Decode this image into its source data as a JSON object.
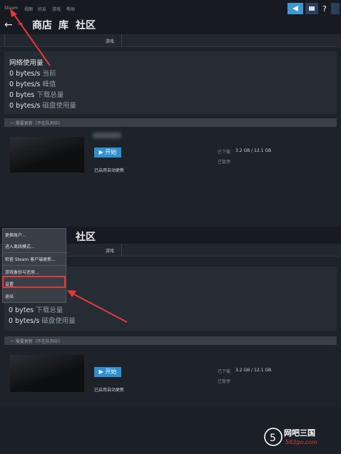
{
  "top": {
    "menu": [
      "Steam",
      "视图",
      "好友",
      "游戏",
      "帮助"
    ],
    "nav": {
      "store": "商店",
      "library": "库",
      "community": "社区"
    },
    "subtab": "游戏"
  },
  "netbox": {
    "title": "网络使用量",
    "rows": [
      {
        "value": "0 bytes/s",
        "label": "当前"
      },
      {
        "value": "0 bytes/s",
        "label": "峰值"
      },
      {
        "value": "0 bytes",
        "label": "下载总量"
      },
      {
        "value": "0 bytes/s",
        "label": "磁盘使用量"
      }
    ]
  },
  "section_header": "一 需要更新（不在队列中）",
  "game": {
    "play_label": "开始",
    "auto_update": "已启用自动更新",
    "downloaded_label": "已下载",
    "downloaded_value": "3.2 GB / 12.1 GB",
    "paused": "已暂停"
  },
  "bottom": {
    "nav_community": "社区",
    "subtab": "游戏",
    "rows": [
      {
        "value": "0 bytes",
        "label": "下载总量"
      },
      {
        "value": "0 bytes/s",
        "label": "磁盘使用量"
      }
    ]
  },
  "dropdown": {
    "items": [
      "更换账户...",
      "进入离线模式...",
      "检查 Steam 客户端更新...",
      "游戏备份与还原...",
      "设置",
      "退出"
    ]
  },
  "watermark": {
    "logo_text": "网吧三国",
    "logo_url": "583go.com"
  }
}
